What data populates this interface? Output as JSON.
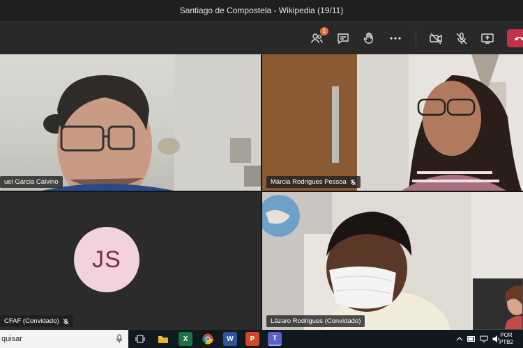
{
  "window": {
    "title": "Santiago de Compostela - Wikipedia (19/11)"
  },
  "toolbar": {
    "participants_badge": "1",
    "items": [
      {
        "name": "participants-icon"
      },
      {
        "name": "chat-icon"
      },
      {
        "name": "raise-hand-icon"
      },
      {
        "name": "more-options-icon"
      },
      {
        "name": "camera-off-icon"
      },
      {
        "name": "mic-muted-icon"
      },
      {
        "name": "share-screen-icon"
      },
      {
        "name": "hang-up-icon"
      }
    ],
    "hangup_color": "#c4314b"
  },
  "participants": [
    {
      "name": "uel Garcia Calvino",
      "muted": false
    },
    {
      "name": "Márcia Rodrigues Pessoa",
      "muted": true
    },
    {
      "name": "CFAF (Convidado)",
      "initials": "JS",
      "muted": true
    },
    {
      "name": "Lázaro Rodrigues (Convidado)",
      "muted": false
    }
  ],
  "taskbar": {
    "search_text": "quisar",
    "apps": [
      "task-view",
      "file-explorer",
      "excel",
      "chrome",
      "word",
      "powerpoint",
      "teams"
    ],
    "lang_top": "POR",
    "lang_bottom": "PTB2"
  },
  "colors": {
    "accent": "#c4314b",
    "avatar_bg": "#f2d3dc",
    "avatar_fg": "#7d2d4d",
    "badge": "#e3752f"
  }
}
